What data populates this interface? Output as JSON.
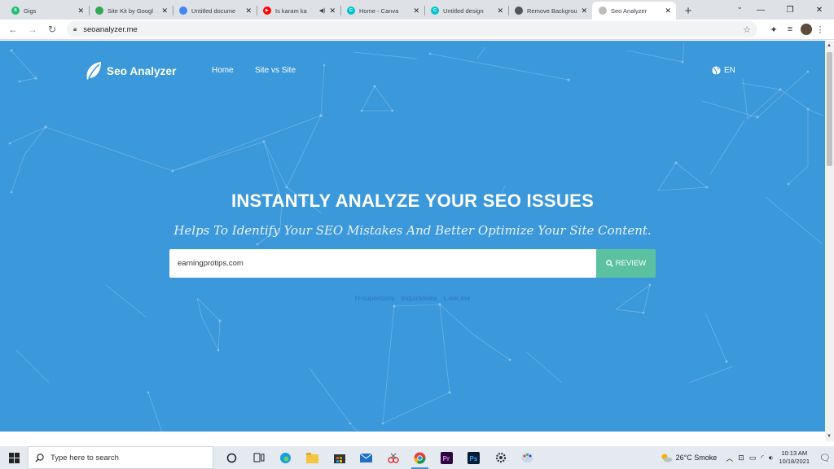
{
  "browser": {
    "tabs": [
      {
        "title": "Gigs",
        "favicon_color": "#1dbf73",
        "favicon_glyph": "fi",
        "icon": "fiverr-icon",
        "active": false
      },
      {
        "title": "Site Kit by Googl",
        "favicon_color": "#34a853",
        "favicon_glyph": "",
        "icon": "site-kit-icon",
        "active": false
      },
      {
        "title": "Untitled docume",
        "favicon_color": "#4285f4",
        "favicon_glyph": "",
        "icon": "google-docs-icon",
        "active": false
      },
      {
        "title": "Is karam ka",
        "favicon_color": "#ff0000",
        "favicon_glyph": "▶",
        "icon": "youtube-icon",
        "active": false,
        "extra": "◀)"
      },
      {
        "title": "Home - Canva",
        "favicon_color": "#00c4cc",
        "favicon_glyph": "C",
        "icon": "canva-icon",
        "active": false
      },
      {
        "title": "Untitled design",
        "favicon_color": "#00c4cc",
        "favicon_glyph": "C",
        "icon": "canva-icon",
        "active": false
      },
      {
        "title": "Remove Backgrou",
        "favicon_color": "#555555",
        "favicon_glyph": "",
        "icon": "remove-bg-icon",
        "active": false
      },
      {
        "title": "Seo Analyzer",
        "favicon_color": "#bdbdbd",
        "favicon_glyph": "",
        "icon": "seo-analyzer-icon",
        "active": true
      }
    ],
    "url": "seoanalyzer.me"
  },
  "site": {
    "logo_text": "Seo Analyzer",
    "nav": {
      "home": "Home",
      "site_vs_site": "Site vs Site"
    },
    "language": "EN",
    "hero_title": "INSTANTLY ANALYZE YOUR SEO ISSUES",
    "hero_subtitle": "Helps To Identify Your SEO Mistakes And Better Optimize Your Site Content.",
    "search_value": "earningprotips.com",
    "review_label": "REVIEW",
    "links": [
      "H-supertools",
      "Inquicklinks",
      "L-ink.me"
    ],
    "colors": {
      "background": "#3a98db",
      "review_button": "#5cc1a1"
    }
  },
  "taskbar": {
    "search_placeholder": "Type here to search",
    "weather": "26°C  Smoke",
    "time": "10:13 AM",
    "date": "10/18/2021"
  }
}
